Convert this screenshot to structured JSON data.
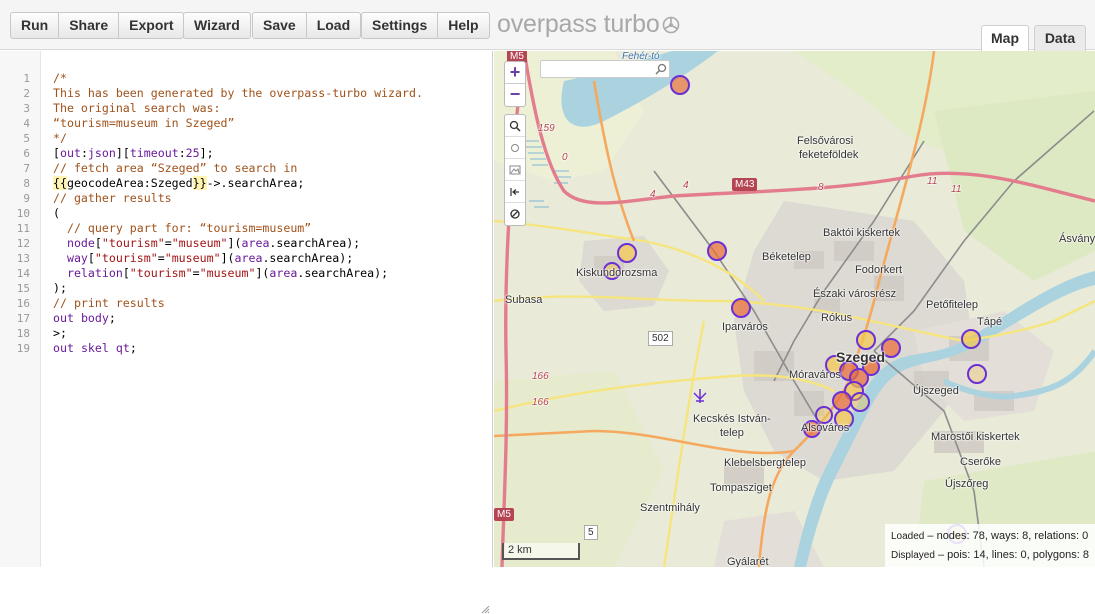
{
  "toolbar": {
    "run": "Run",
    "share": "Share",
    "export": "Export",
    "wizard": "Wizard",
    "save": "Save",
    "load": "Load",
    "settings": "Settings",
    "help": "Help"
  },
  "app": {
    "title": "overpass turbo"
  },
  "tabs": {
    "map": "Map",
    "data": "Data"
  },
  "editor": {
    "line_numbers": [
      "1",
      "2",
      "3",
      "4",
      "5",
      "6",
      "7",
      "8",
      "9",
      "10",
      "11",
      "12",
      "13",
      "14",
      "15",
      "16",
      "17",
      "18",
      "19"
    ],
    "lines": [
      "/*",
      "This has been generated by the overpass-turbo wizard.",
      "The original search was:",
      "“tourism=museum in Szeged”",
      "*/",
      "[out:json][timeout:25];",
      "// fetch area “Szeged” to search in",
      "{{geocodeArea:Szeged}}->.searchArea;",
      "// gather results",
      "(",
      "  // query part for: “tourism=museum”",
      "  node[\"tourism\"=\"museum\"](area.searchArea);",
      "  way[\"tourism\"=\"museum\"](area.searchArea);",
      "  relation[\"tourism\"=\"museum\"](area.searchArea);",
      ");",
      "// print results",
      "out body;",
      ">;",
      "out skel qt;"
    ]
  },
  "map": {
    "zoom_in": "+",
    "zoom_out": "−",
    "search_placeholder": "",
    "scale": "2 km",
    "labels": {
      "feher_to": "Fehér-tó",
      "felsovarosi": "Felsővárosi",
      "feketefoldek": "feketeföldek",
      "baktoi": "Baktói kiskertek",
      "asvany": "Ásvány",
      "beketelep": "Béketelep",
      "fodorkert": "Fodorkert",
      "kiskundorozsma": "Kiskundorozsma",
      "eszaki": "Északi városrész",
      "petofitelep": "Petőfitelep",
      "subasa": "Subasa",
      "iparvaros": "Iparváros",
      "rokus": "Rókus",
      "tape": "Tápé",
      "szeged": "Szeged",
      "moravaros": "Móraváros",
      "ujszeged": "Újszeged",
      "kecskes": "Kecskés István-",
      "telep": "telep",
      "alsovaros": "Alsóváros",
      "marostoi": "Marostői kiskertek",
      "klebelsberg": "Klebelsbergtelep",
      "cserke": "Cserőke",
      "tompasziget": "Tompasziget",
      "ujszoreg": "Újszőreg",
      "szentmihaly": "Szentmihály",
      "gyalaret": "Gyálarét"
    },
    "roads": {
      "m5_top": "M5",
      "m5_bottom": "M5",
      "m43": "M43",
      "r159": "159",
      "r0": "0",
      "r4a": "4",
      "r4b": "4",
      "r8": "8",
      "r11a": "11",
      "r11b": "11",
      "r502": "502",
      "r166a": "166",
      "r166b": "166",
      "r5": "5"
    },
    "stats": {
      "loaded_label": "Loaded",
      "loaded_text": " – nodes: 78, ways: 8, relations: 0",
      "displayed_label": "Displayed",
      "displayed_text": " – pois: 14, lines: 0, polygons: 8"
    }
  },
  "colors": {
    "poi_stroke": "#6b2fd6",
    "poi_fill_yellow": "#f5c84a",
    "poi_fill_red": "#e8703d",
    "motorway": "#e37d8d",
    "trunk": "#f4a95e",
    "water": "#aad3df"
  }
}
